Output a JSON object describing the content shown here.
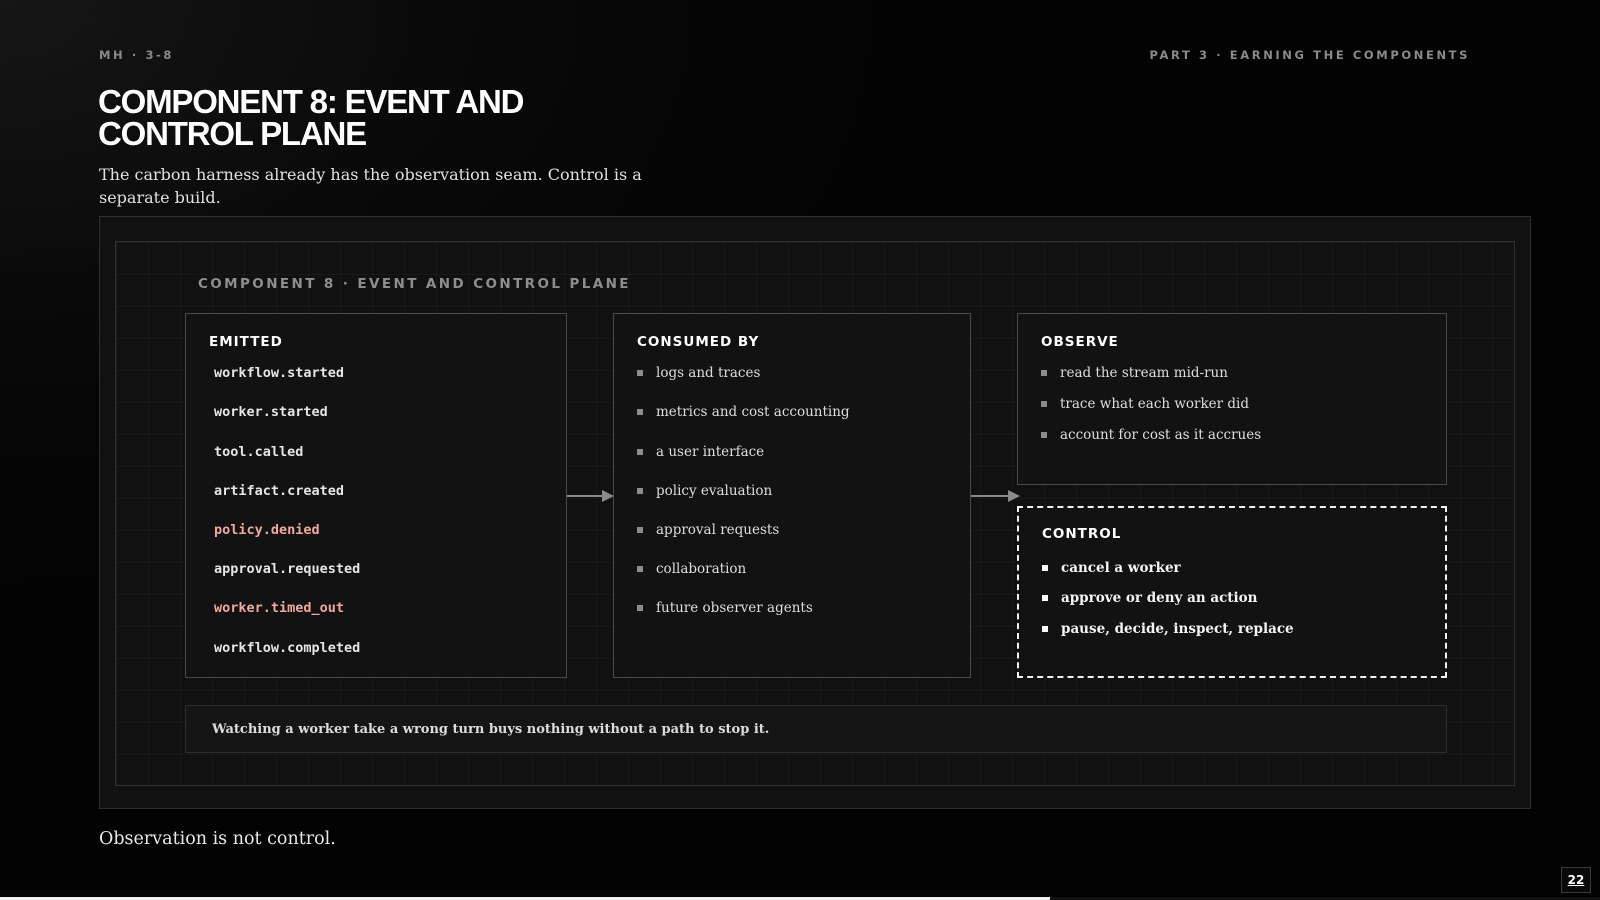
{
  "header": {
    "slide_id": "MH · 3-8",
    "section": "PART 3 · EARNING THE COMPONENTS"
  },
  "title": "COMPONENT 8: EVENT AND\nCONTROL PLANE",
  "subtitle": "The carbon harness already has the observation seam. Control is a separate build.",
  "diagram": {
    "heading": "COMPONENT 8 · EVENT AND CONTROL PLANE",
    "emitted": {
      "label": "EMITTED",
      "events": [
        {
          "name": "workflow.started",
          "highlight": false
        },
        {
          "name": "worker.started",
          "highlight": false
        },
        {
          "name": "tool.called",
          "highlight": false
        },
        {
          "name": "artifact.created",
          "highlight": false
        },
        {
          "name": "policy.denied",
          "highlight": true
        },
        {
          "name": "approval.requested",
          "highlight": false
        },
        {
          "name": "worker.timed_out",
          "highlight": true
        },
        {
          "name": "workflow.completed",
          "highlight": false
        }
      ]
    },
    "consumed_by": {
      "label": "CONSUMED BY",
      "items": [
        "logs and traces",
        "metrics and cost accounting",
        "a user interface",
        "policy evaluation",
        "approval requests",
        "collaboration",
        "future observer agents"
      ]
    },
    "observe": {
      "label": "OBSERVE",
      "items": [
        "read the stream mid-run",
        "trace what each worker did",
        "account for cost as it accrues"
      ]
    },
    "control": {
      "label": "CONTROL",
      "items": [
        "cancel a worker",
        "approve or deny an action",
        "pause, decide, inspect, replace"
      ]
    },
    "note": "Watching a worker take a wrong turn buys nothing without a path to stop it."
  },
  "footer": {
    "takeaway": "Observation is not control.",
    "page_number": "22",
    "progress_fraction": 0.656
  },
  "colors": {
    "background": "#050505",
    "alert_event": "#f0a9a0",
    "box_border": "#4a4a4a",
    "control_border": "#f2f2f2"
  }
}
